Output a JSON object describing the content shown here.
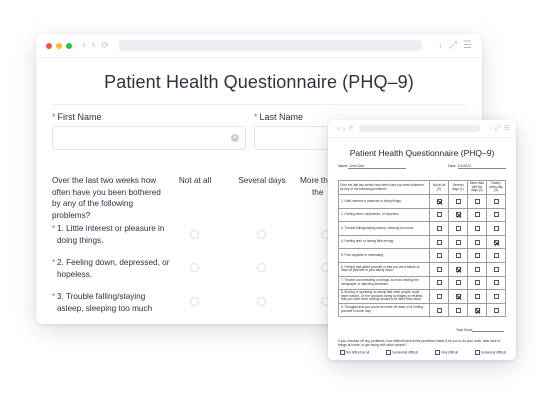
{
  "main_window": {
    "colors": {
      "dot_red": "#f1544c",
      "dot_yellow": "#f7be35",
      "dot_green": "#27c53f"
    },
    "title": "Patient Health Questionnaire (PHQ–9)",
    "fields": {
      "first_name": {
        "required_mark": "*",
        "label": "First Name",
        "value": ""
      },
      "last_name": {
        "required_mark": "*",
        "label": "Last Name",
        "value": ""
      }
    },
    "question_header": "Over the last two weeks how often have you been bothered by any of the following problems?",
    "columns": [
      "Not at all",
      "Several days",
      "More than half the days"
    ],
    "columns_visible": [
      "Not at all",
      "Several days",
      "More th",
      "the"
    ],
    "questions": [
      {
        "mark": "*",
        "text": "1. Little interest or pleasure in doing things."
      },
      {
        "mark": "*",
        "text": "2. Feeling down, depressed, or hopeless."
      },
      {
        "mark": "*",
        "text": "3. Trouble falling/staying asleep, sleeping too much"
      }
    ]
  },
  "paper_window": {
    "title": "Patient Health Questionnaire (PHQ–9)",
    "name_label": "Name:",
    "name_value": "John Doe",
    "date_label": "Date:",
    "date_value": "1/1/2021",
    "table_header": "Over the last two weeks how often have you been bothered by any of the following problems?",
    "columns": [
      "Not at all (0)",
      "Several days (1)",
      "More than half the days (2)",
      "Nearly every day (3)"
    ],
    "rows": [
      {
        "text": "1. Little interest or pleasure in doing things.",
        "checked": 0
      },
      {
        "text": "2. Feeling down, depressed, or hopeless.",
        "checked": 1
      },
      {
        "text": "3. Trouble falling/staying asleep, sleeping too much.",
        "checked": null
      },
      {
        "text": "4. Feeling tired or having little energy.",
        "checked": 3
      },
      {
        "text": "5. Poor appetite or overeating.",
        "checked": null
      },
      {
        "text": "6. Feeling bad about yourself or that you are a failure or have let yourself or your family down.",
        "checked": 1
      },
      {
        "text": "7. Trouble concentrating on things, such as reading the newspaper or watching television.",
        "checked": null
      },
      {
        "text": "8. Moving or speaking so slowly that other people could have noticed. Or the opposite; being so fidgety or restless that you have been moving around a lot more than usual.",
        "checked": 1
      },
      {
        "text": "9. Thoughts that you would be better off dead or of hurting yourself in some way.",
        "checked": 2
      }
    ],
    "total_label": "Total Score",
    "difficulty_question": "If you checked off any problems, how difficult have these problems made it for you to do your work, take care of things at home, or get along with other people?",
    "difficulty_options": [
      "Not difficult at all",
      "Somewhat difficult",
      "Very difficult",
      "Extremely difficult"
    ]
  }
}
